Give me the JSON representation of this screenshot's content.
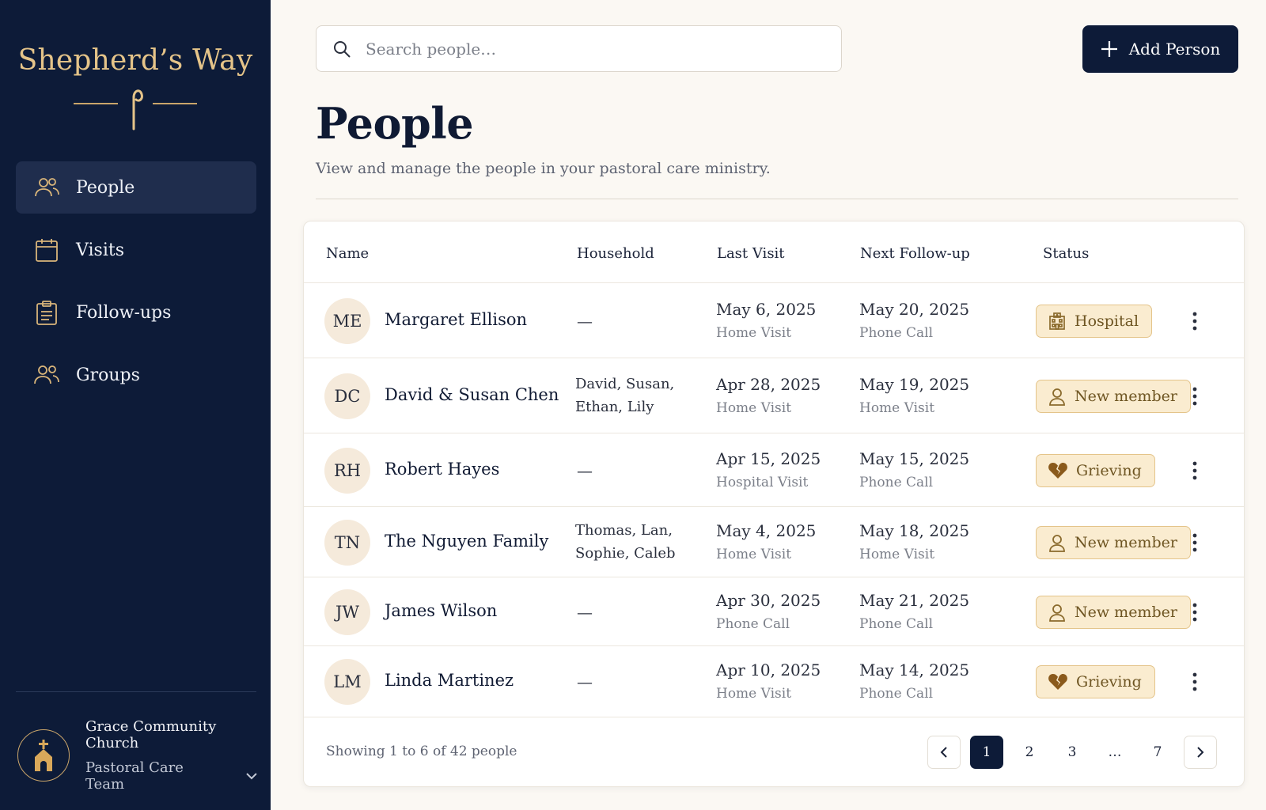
{
  "brand": {
    "title": "Shepherd’s Way"
  },
  "nav": {
    "items": [
      {
        "label": "People",
        "icon": "people-icon",
        "active": true
      },
      {
        "label": "Visits",
        "icon": "calendar-icon",
        "active": false
      },
      {
        "label": "Follow-ups",
        "icon": "clipboard-icon",
        "active": false
      },
      {
        "label": "Groups",
        "icon": "groups-icon",
        "active": false
      }
    ]
  },
  "org": {
    "name": "Grace Community Church",
    "team": "Pastoral Care Team",
    "icon": "church-icon"
  },
  "search": {
    "placeholder": "Search people…",
    "value": ""
  },
  "add_button": {
    "label": "Add Person"
  },
  "page": {
    "title": "People",
    "subtitle": "View and manage the people in your pastoral care ministry."
  },
  "table": {
    "columns": [
      "Name",
      "Household",
      "Last Visit",
      "Next Follow-up",
      "Status"
    ],
    "rows": [
      {
        "initials": "ME",
        "name": "Margaret Ellison",
        "household_lines": [
          "—"
        ],
        "last_visit": "May 6, 2025",
        "last_type": "Home Visit",
        "next_followup": "May 20, 2025",
        "next_type": "Phone Call",
        "status": "Hospital",
        "status_icon": "hospital-icon"
      },
      {
        "initials": "DC",
        "name": "David & Susan Chen",
        "household_lines": [
          "David, Susan,",
          "Ethan, Lily"
        ],
        "last_visit": "Apr 28, 2025",
        "last_type": "Home Visit",
        "next_followup": "May 19, 2025",
        "next_type": "Home Visit",
        "status": "New member",
        "status_icon": "person-icon"
      },
      {
        "initials": "RH",
        "name": "Robert Hayes",
        "household_lines": [
          "—"
        ],
        "last_visit": "Apr 15, 2025",
        "last_type": "Hospital Visit",
        "next_followup": "May 15, 2025",
        "next_type": "Phone Call",
        "status": "Grieving",
        "status_icon": "broken-heart-icon"
      },
      {
        "initials": "TN",
        "name": "The Nguyen Family",
        "household_lines": [
          "Thomas, Lan,",
          "Sophie, Caleb"
        ],
        "last_visit": "May 4, 2025",
        "last_type": "Home Visit",
        "next_followup": "May 18, 2025",
        "next_type": "Home Visit",
        "status": "New member",
        "status_icon": "person-icon"
      },
      {
        "initials": "JW",
        "name": "James Wilson",
        "household_lines": [
          "—"
        ],
        "last_visit": "Apr 30, 2025",
        "last_type": "Phone Call",
        "next_followup": "May 21, 2025",
        "next_type": "Phone Call",
        "status": "New member",
        "status_icon": "person-icon"
      },
      {
        "initials": "LM",
        "name": "Linda Martinez",
        "household_lines": [
          "—"
        ],
        "last_visit": "Apr 10, 2025",
        "last_type": "Home Visit",
        "next_followup": "May 14, 2025",
        "next_type": "Phone Call",
        "status": "Grieving",
        "status_icon": "broken-heart-icon"
      }
    ]
  },
  "footer": {
    "showing": "Showing 1 to 6 of 42 people",
    "pages": [
      "1",
      "2",
      "3",
      "…",
      "7"
    ],
    "current_page": "1"
  },
  "colors": {
    "sidebar_bg": "#0d1b38",
    "brand_gold": "#e5c489",
    "badge_bg": "#faecd0",
    "badge_border": "#e4c48a",
    "badge_text": "#6e5522",
    "page_bg": "#fbf8f3"
  }
}
